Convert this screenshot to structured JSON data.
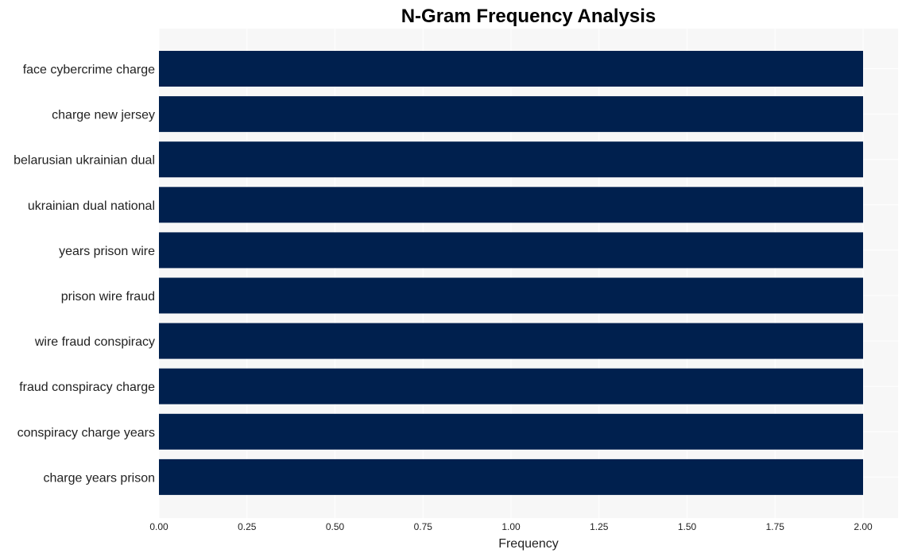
{
  "chart_data": {
    "type": "bar",
    "orientation": "horizontal",
    "title": "N-Gram Frequency Analysis",
    "xlabel": "Frequency",
    "ylabel": "",
    "categories": [
      "face cybercrime charge",
      "charge new jersey",
      "belarusian ukrainian dual",
      "ukrainian dual national",
      "years prison wire",
      "prison wire fraud",
      "wire fraud conspiracy",
      "fraud conspiracy charge",
      "conspiracy charge years",
      "charge years prison"
    ],
    "values": [
      2,
      2,
      2,
      2,
      2,
      2,
      2,
      2,
      2,
      2
    ],
    "xlim": [
      0,
      2.1
    ],
    "xticks": [
      0,
      0.25,
      0.5,
      0.75,
      1.0,
      1.25,
      1.5,
      1.75,
      2.0
    ],
    "xtick_labels": [
      "0.00",
      "0.25",
      "0.50",
      "0.75",
      "1.00",
      "1.25",
      "1.50",
      "1.75",
      "2.00"
    ],
    "grid": true,
    "legend": "none",
    "colors": {
      "bar": "#00204e",
      "plot_bg": "#f7f7f7",
      "grid": "#ffffff"
    }
  }
}
